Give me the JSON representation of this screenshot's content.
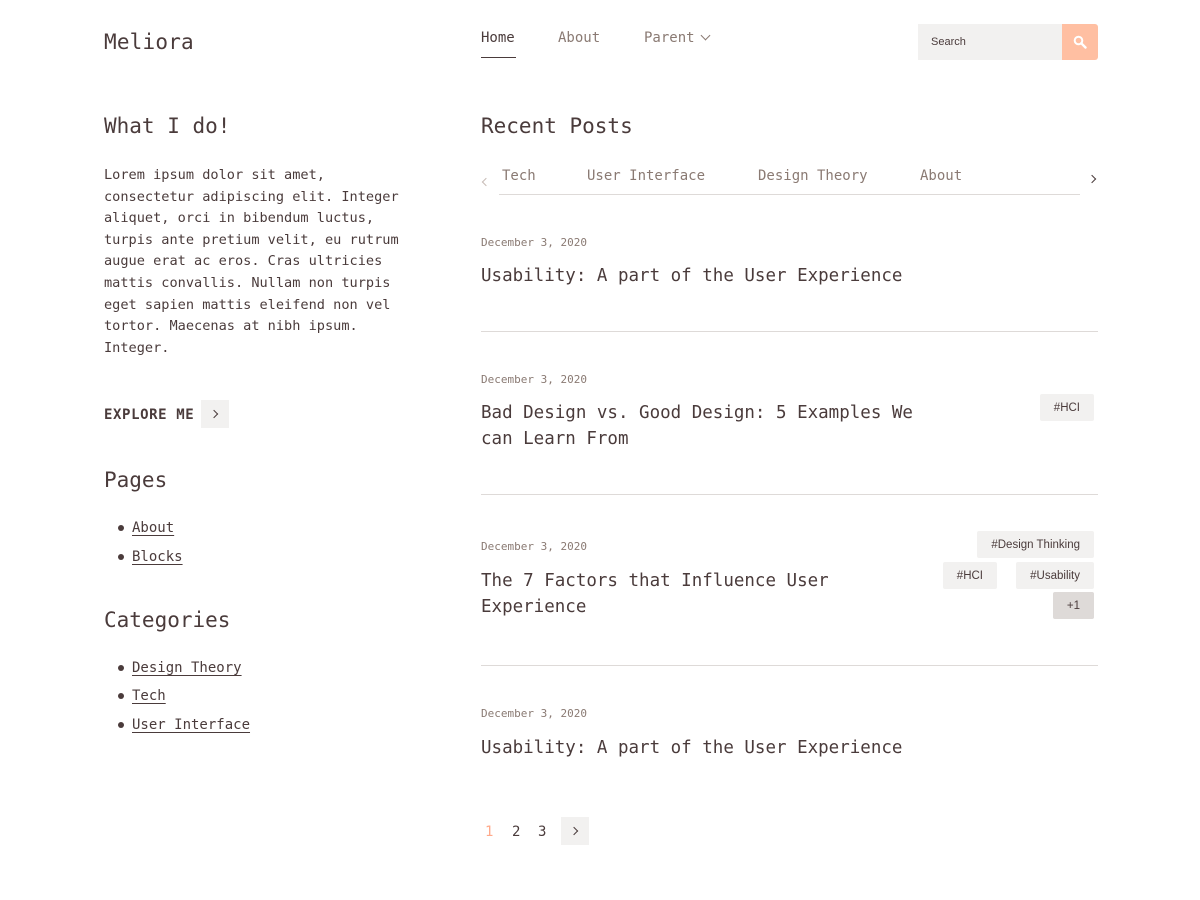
{
  "header": {
    "logo": "Meliora",
    "nav": [
      {
        "label": "Home"
      },
      {
        "label": "About"
      },
      {
        "label": "Parent"
      }
    ],
    "search": {
      "placeholder": "Search",
      "icon": "search-icon"
    }
  },
  "sidebar": {
    "about_heading": "What I do!",
    "about_text": "Lorem ipsum dolor sit amet, consectetur adipiscing elit. Integer aliquet, orci in bibendum luctus, turpis ante pretium velit, eu rutrum augue erat ac eros. Cras ultricies mattis convallis. Nullam non turpis eget sapien mattis eleifend non vel tortor. Maecenas at nibh ipsum. Integer.",
    "explore_label": "EXPLORE ME",
    "pages_heading": "Pages",
    "pages": [
      "About",
      "Blocks"
    ],
    "categories_heading": "Categories",
    "categories": [
      "Design Theory",
      "Tech",
      "User Interface"
    ]
  },
  "main": {
    "heading": "Recent Posts",
    "tabs": [
      "Tech",
      "User Interface",
      "Design Theory",
      "About"
    ],
    "posts": [
      {
        "date": "December 3, 2020",
        "title": "Usability: A part of the User Experience",
        "tags": []
      },
      {
        "date": "December 3, 2020",
        "title": "Bad Design vs. Good Design: 5 Examples We can Learn From",
        "tags": [
          "#HCI"
        ]
      },
      {
        "date": "December 3, 2020",
        "title": "The 7 Factors that Influence User Experience",
        "tags": [
          "#Design Thinking",
          "#HCI",
          "#Usability"
        ],
        "more": "+1"
      },
      {
        "date": "December 3, 2020",
        "title": "Usability: A part of the User Experience",
        "tags": []
      }
    ],
    "pagination": {
      "pages": [
        "1",
        "2",
        "3"
      ],
      "current": "1"
    }
  },
  "colors": {
    "text": "#4a3b3b",
    "muted": "#8a7a73",
    "accent": "#ffbfa2",
    "chip_bg": "#f2f1f0",
    "divider": "#dedad8"
  }
}
